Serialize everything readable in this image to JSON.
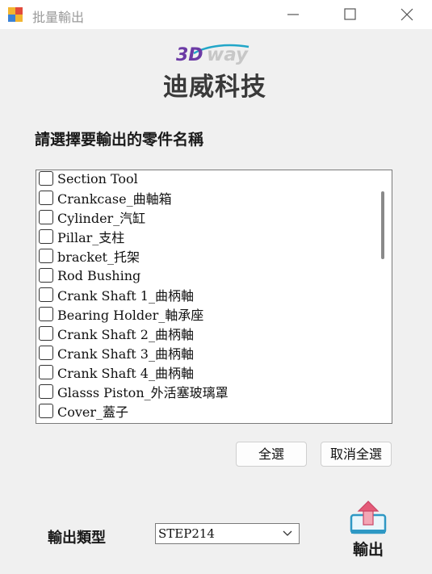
{
  "window": {
    "title": "批量輸出"
  },
  "logo": {
    "brand_prefix": "3D",
    "brand_suffix": "way",
    "company_name": "迪威科技"
  },
  "instruction": "請選擇要輸出的零件名稱",
  "parts": [
    {
      "label": "Section Tool",
      "checked": false
    },
    {
      "label": "Crankcase_曲軸箱",
      "checked": false
    },
    {
      "label": "Cylinder_汽缸",
      "checked": false
    },
    {
      "label": "Pillar_支柱",
      "checked": false
    },
    {
      "label": "bracket_托架",
      "checked": false
    },
    {
      "label": "Rod Bushing",
      "checked": false
    },
    {
      "label": "Crank Shaft 1_曲柄軸",
      "checked": false
    },
    {
      "label": "Bearing Holder_軸承座",
      "checked": false
    },
    {
      "label": "Crank Shaft 2_曲柄軸",
      "checked": false
    },
    {
      "label": "Crank Shaft 3_曲柄軸",
      "checked": false
    },
    {
      "label": "Crank Shaft 4_曲柄軸",
      "checked": false
    },
    {
      "label": "Glasss Piston_外活塞玻璃罩",
      "checked": false
    },
    {
      "label": "Cover_蓋子",
      "checked": false
    }
  ],
  "buttons": {
    "select_all": "全選",
    "deselect_all": "取消全選",
    "export": "輸出"
  },
  "output_type": {
    "label": "輸出類型",
    "value": "STEP214"
  },
  "colors": {
    "logo_purple": "#6b3aa5",
    "logo_teal": "#21a6c8",
    "export_arrow": "#e45b78",
    "export_tray": "#2e98c4"
  }
}
